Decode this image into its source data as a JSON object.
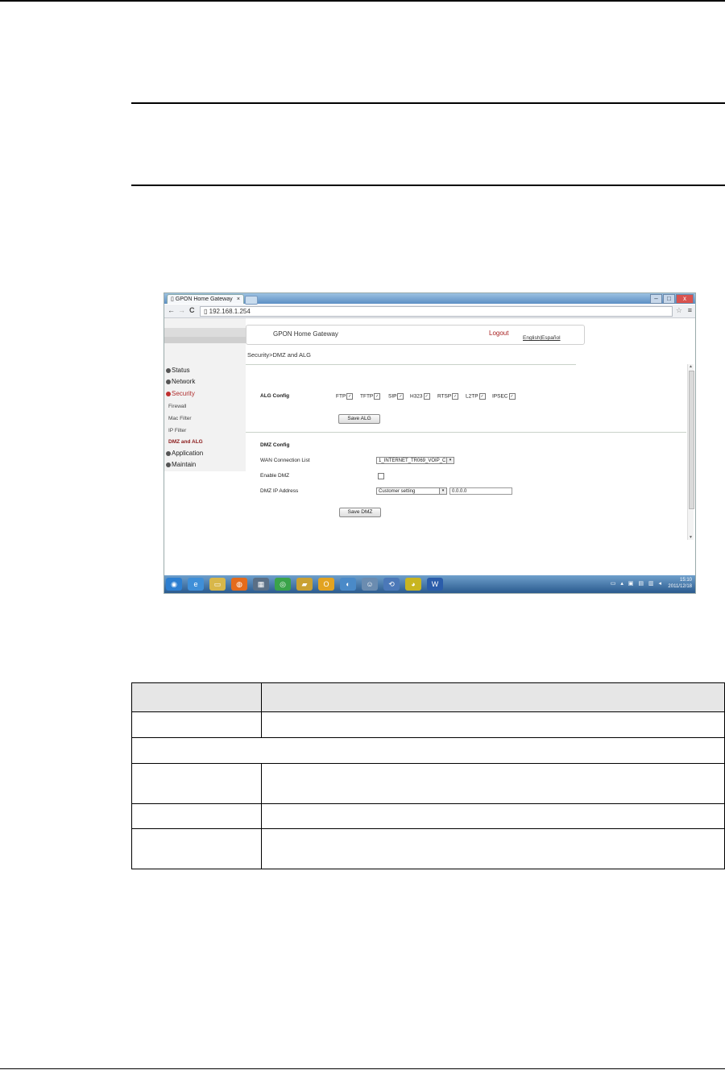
{
  "browser": {
    "tab_title": "GPON Home Gateway",
    "tab_close": "×",
    "url": "192.168.1.254",
    "back_icon": "←",
    "forward_icon": "→",
    "reload_icon": "C",
    "star_icon": "☆",
    "menu_icon": "≡",
    "win_min": "–",
    "win_max": "□",
    "win_close": "x"
  },
  "header": {
    "brand": "GPON Home Gateway",
    "logout": "Logout",
    "lang_english": "English",
    "lang_sep": "|",
    "lang_spanish": "Español"
  },
  "breadcrumb": "Security>DMZ and ALG",
  "sidebar": {
    "items": [
      {
        "label": "Status"
      },
      {
        "label": "Network"
      },
      {
        "label": "Security"
      },
      {
        "label": "Application"
      },
      {
        "label": "Maintain"
      }
    ],
    "security_sub": [
      {
        "label": "Firewall"
      },
      {
        "label": "Mac Filter"
      },
      {
        "label": "IP Filter"
      },
      {
        "label": "DMZ and ALG"
      }
    ]
  },
  "alg": {
    "title": "ALG Config",
    "items": [
      {
        "label": "FTP",
        "checked": true
      },
      {
        "label": "TFTP",
        "checked": true
      },
      {
        "label": "SIP",
        "checked": true
      },
      {
        "label": "H323",
        "checked": true
      },
      {
        "label": "RTSP",
        "checked": true
      },
      {
        "label": "L2TP",
        "checked": true
      },
      {
        "label": "IPSEC",
        "checked": true
      }
    ],
    "check_glyph": "✓",
    "save_label": "Save ALG"
  },
  "dmz": {
    "title": "DMZ Config",
    "wan_label": "WAN Connection List",
    "wan_value": "1_INTERNET_TR069_VOIP_C",
    "enable_label": "Enable DMZ",
    "ip_label": "DMZ IP Address",
    "ip_mode_value": "Customer setting",
    "ip_value": "0.0.0.0",
    "save_label": "Save DMZ"
  },
  "taskbar": {
    "time": "15:10",
    "date": "2011/12/18",
    "icons": [
      {
        "name": "start-orb-icon",
        "glyph": "◉",
        "color": "#2d7fd1"
      },
      {
        "name": "ie-icon",
        "glyph": "e",
        "color": "#3f8fd8"
      },
      {
        "name": "explorer-icon",
        "glyph": "▭",
        "color": "#d8b74a"
      },
      {
        "name": "firefox-icon",
        "glyph": "◍",
        "color": "#e46b1c"
      },
      {
        "name": "calculator-icon",
        "glyph": "▦",
        "color": "#5a6f86"
      },
      {
        "name": "chrome-icon",
        "glyph": "◎",
        "color": "#3aa34a"
      },
      {
        "name": "notebook-icon",
        "glyph": "▰",
        "color": "#c9a133"
      },
      {
        "name": "outlook-icon",
        "glyph": "O",
        "color": "#e2a321"
      },
      {
        "name": "globe-icon",
        "glyph": "◐",
        "color": "#4a8ac8"
      },
      {
        "name": "user-icon",
        "glyph": "☺",
        "color": "#6b8cb0"
      },
      {
        "name": "sync-icon",
        "glyph": "⟲",
        "color": "#4b78b8"
      },
      {
        "name": "yellow-app-icon",
        "glyph": "◕",
        "color": "#c8b520"
      },
      {
        "name": "word-icon",
        "glyph": "W",
        "color": "#2a5caa"
      }
    ],
    "tray_icons": "▭ ▴ ▣ ▤ ▥ ◂"
  }
}
